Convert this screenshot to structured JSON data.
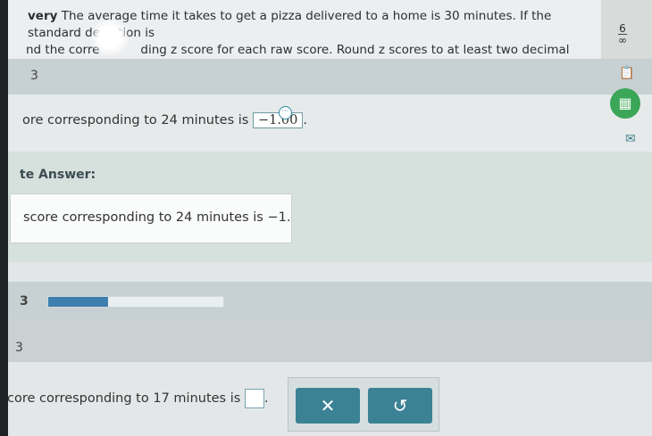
{
  "question": {
    "lead": "very",
    "text_line1": " The average time it takes to get a pizza delivered to a home is 30 minutes. If the standard deviation is",
    "sd_num": "6",
    "sd_den": "∞",
    "text_line2_a": "nd the corre",
    "text_line2_b": "ding z score for each raw score. Round z scores to at least two decimal places."
  },
  "parts": [
    {
      "label": "3"
    },
    {
      "label": "3"
    },
    {
      "label": "3"
    }
  ],
  "part_a": {
    "prefix": "ore corresponding to 24 minutes is",
    "answer": "−1.00",
    "dots": "···",
    "period": "."
  },
  "complete": {
    "title": "te Answer:",
    "text": "score corresponding to 24 minutes is −1."
  },
  "progress": {
    "fraction": 0.34
  },
  "part_c": {
    "prefix": "core corresponding to 17 minutes is",
    "period": "."
  },
  "buttons": {
    "clear": "✕",
    "undo": "↺"
  },
  "icons": {
    "notes": "📋",
    "calculator": "▦",
    "mail": "✉"
  },
  "colors": {
    "accent": "#3c8295",
    "progress": "#3f7fb0",
    "success": "#3ba657"
  }
}
